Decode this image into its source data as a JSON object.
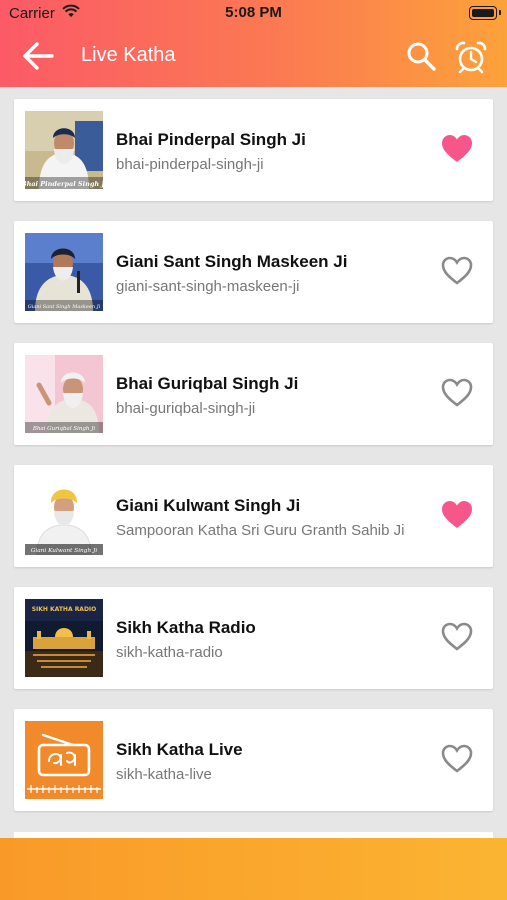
{
  "status_bar": {
    "carrier": "Carrier",
    "time": "5:08 PM"
  },
  "header": {
    "title": "Live Katha"
  },
  "colors": {
    "heart_filled": "#f7568b",
    "heart_outline": "#8a8a8a",
    "accent": "#fb6a5c"
  },
  "items": [
    {
      "name": "Bhai Pinderpal Singh Ji",
      "slug": "bhai-pinderpal-singh-ji",
      "favorite": true,
      "thumb_caption": "Bhai Pinderpal Singh Ji"
    },
    {
      "name": "Giani Sant Singh Maskeen Ji",
      "slug": "giani-sant-singh-maskeen-ji",
      "favorite": false,
      "thumb_caption": "Giani Sant Singh Maskeen Ji"
    },
    {
      "name": "Bhai Guriqbal Singh Ji",
      "slug": "bhai-guriqbal-singh-ji",
      "favorite": false,
      "thumb_caption": "Bhai Guriqbal Singh Ji"
    },
    {
      "name": "Giani Kulwant Singh Ji",
      "slug": "Sampooran Katha Sri Guru Granth Sahib Ji",
      "favorite": true,
      "thumb_caption": "Giani Kulwant Singh Ji"
    },
    {
      "name": "Sikh Katha Radio",
      "slug": "sikh-katha-radio",
      "favorite": false,
      "thumb_caption": "SIKH KATHA RADIO"
    },
    {
      "name": "Sikh Katha Live",
      "slug": "sikh-katha-live",
      "favorite": false,
      "thumb_caption": ""
    }
  ]
}
